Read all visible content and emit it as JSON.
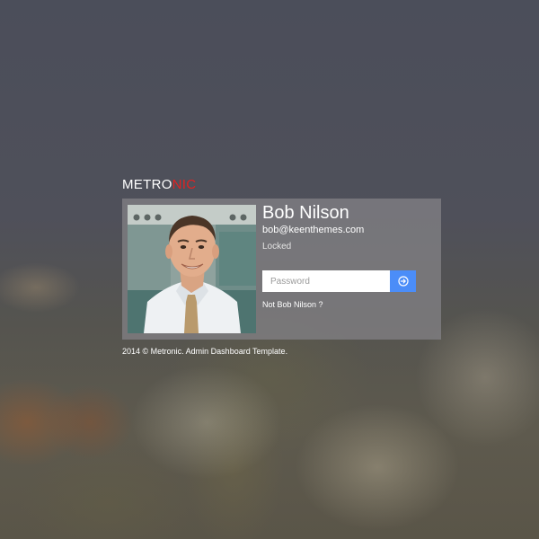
{
  "brand": {
    "logo_part1": "METRO",
    "logo_part2": "NIC",
    "accent_color": "#e02222"
  },
  "lock_card": {
    "user_name": "Bob Nilson",
    "user_email": "bob@keenthemes.com",
    "status_text": "Locked",
    "password_placeholder": "Password",
    "password_value": "",
    "submit_icon": "arrow-circle-right-icon",
    "submit_color": "#4b8df8",
    "not_user_link": "Not Bob Nilson ?"
  },
  "footer": {
    "copyright": "2014 © Metronic. Admin Dashboard Template."
  }
}
